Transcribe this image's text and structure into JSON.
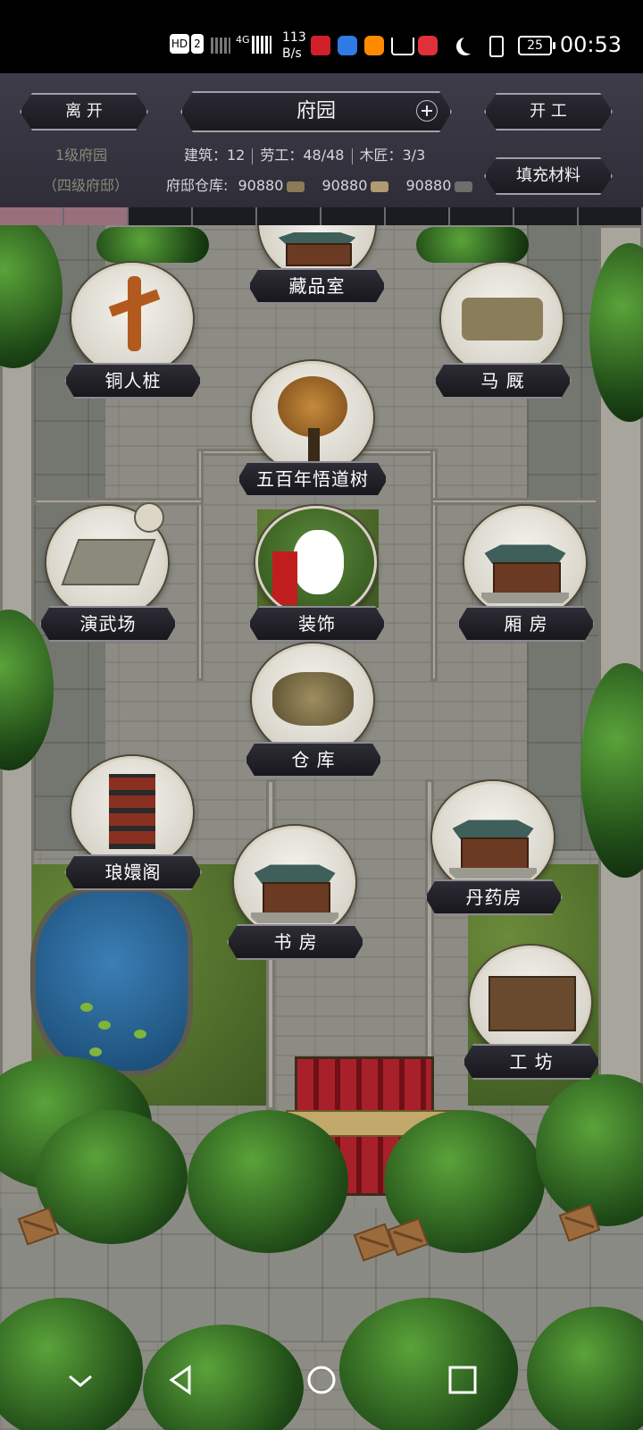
{
  "status_bar": {
    "hd_badge": "HD",
    "sim_badge": "2",
    "network": "4G",
    "speed_value": "113",
    "speed_unit": "B/s",
    "app_icons": [
      "qidian-icon",
      "music-icon",
      "taobao-icon",
      "cart-icon",
      "reader-icon"
    ],
    "battery": "25",
    "time": "00:53"
  },
  "header": {
    "leave_button": "离 开",
    "title": "府园",
    "start_work_button": "开 工",
    "fill_materials_button": "填充材料",
    "level": "1级府园",
    "rank": "（四级府邸）",
    "buildings": "建筑：12",
    "workers": "劳工：48/48",
    "carpenters": "木匠：3/3",
    "warehouse_label": "府邸仓库:",
    "resources": [
      {
        "value": "90880",
        "icon": "stone-icon"
      },
      {
        "value": "90880",
        "icon": "wood-icon"
      },
      {
        "value": "90880",
        "icon": "iron-icon"
      }
    ]
  },
  "progress": {
    "filled_segments": 2,
    "total_segments": 10,
    "filled_color": "#9a6f7c"
  },
  "buildings": [
    {
      "id": "collection",
      "label": "藏品室"
    },
    {
      "id": "bronze",
      "label": "铜人桩"
    },
    {
      "id": "stable",
      "label": "马 厩"
    },
    {
      "id": "tree",
      "label": "五百年悟道树"
    },
    {
      "id": "arena",
      "label": "演武场"
    },
    {
      "id": "decor",
      "label": "装饰"
    },
    {
      "id": "wing",
      "label": "厢 房"
    },
    {
      "id": "storage",
      "label": "仓 库"
    },
    {
      "id": "pavilion",
      "label": "琅嬛阁"
    },
    {
      "id": "alchemy",
      "label": "丹药房"
    },
    {
      "id": "study",
      "label": "书 房"
    },
    {
      "id": "workshop",
      "label": "工 坊"
    }
  ],
  "nav_bar": {
    "back": "back-icon",
    "home": "home-icon",
    "recents": "recents-icon",
    "collapse": "chevron-down-icon"
  }
}
